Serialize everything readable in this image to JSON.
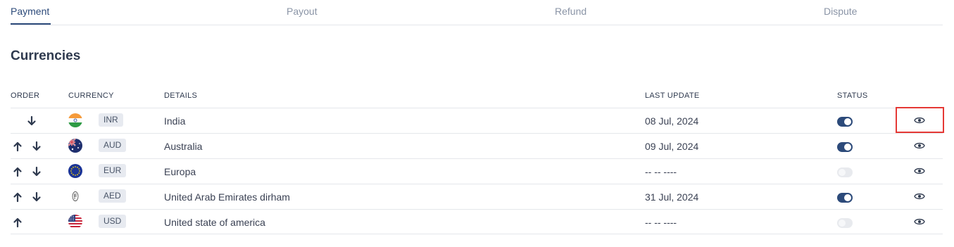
{
  "tabs": [
    {
      "label": "Payment",
      "active": true
    },
    {
      "label": "Payout",
      "active": false
    },
    {
      "label": "Refund",
      "active": false
    },
    {
      "label": "Dispute",
      "active": false
    }
  ],
  "section_title": "Currencies",
  "columns": {
    "order": "ORDER",
    "currency": "CURRENCY",
    "details": "DETAILS",
    "last_update": "LAST UPDATE",
    "status": "STATUS"
  },
  "rows": [
    {
      "code": "INR",
      "flag": "india-flag-icon",
      "details": "India",
      "last_update": "08 Jul, 2024",
      "status_enabled": true,
      "can_move_up": false,
      "can_move_down": true
    },
    {
      "code": "AUD",
      "flag": "australia-flag-icon",
      "details": "Australia",
      "last_update": "09 Jul, 2024",
      "status_enabled": true,
      "can_move_up": true,
      "can_move_down": true
    },
    {
      "code": "EUR",
      "flag": "eu-flag-icon",
      "details": "Europa",
      "last_update": "-- -- ----",
      "status_enabled": false,
      "can_move_up": true,
      "can_move_down": true
    },
    {
      "code": "AED",
      "flag": "aed-symbol-icon",
      "details": "United Arab Emirates dirham",
      "last_update": "31 Jul, 2024",
      "status_enabled": true,
      "can_move_up": true,
      "can_move_down": true
    },
    {
      "code": "USD",
      "flag": "usa-flag-icon",
      "details": "United state of america",
      "last_update": "-- -- ----",
      "status_enabled": false,
      "can_move_up": true,
      "can_move_down": false
    }
  ],
  "colors": {
    "accent": "#2c4a7a",
    "highlight": "#e53935",
    "badge_bg": "#e7eaf0"
  }
}
